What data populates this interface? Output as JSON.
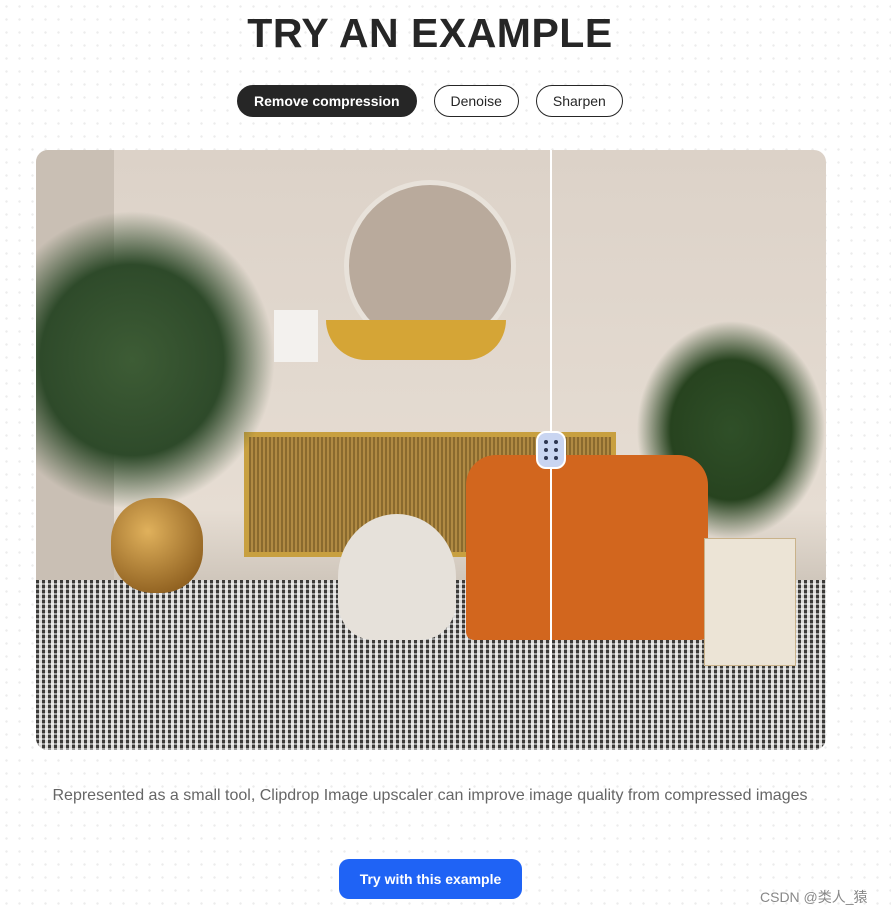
{
  "title": "TRY AN EXAMPLE",
  "tabs": [
    {
      "label": "Remove compression",
      "active": true
    },
    {
      "label": "Denoise",
      "active": false
    },
    {
      "label": "Sharpen",
      "active": false
    }
  ],
  "comparison": {
    "image": "living room with orange armchair, plants and patterned rug",
    "split_percent": 65,
    "handle_icon": "drag-dots-icon"
  },
  "description": "Represented as a small tool, Clipdrop Image upscaler can improve image quality from compressed images",
  "cta_label": "Try with this example",
  "watermark": "CSDN @类人_猿",
  "colors": {
    "primary": "#1f63f5",
    "dark": "#262626"
  }
}
